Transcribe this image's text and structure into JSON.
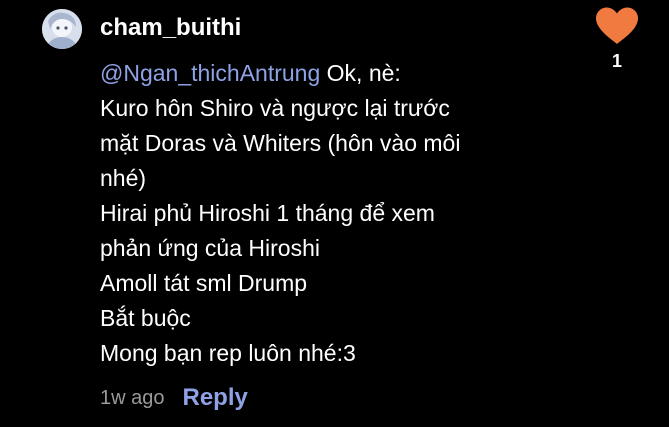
{
  "comment": {
    "avatar_icon": "user-avatar-anime",
    "username": "cham_buithi",
    "mention": "@Ngan_thichAntrung",
    "first_line_rest": " Ok, nè:",
    "lines": [
      "Kuro hôn Shiro và ngược lại trước",
      "mặt Doras và Whiters (hôn vào môi",
      "nhé)",
      "Hirai phủ Hiroshi 1 tháng để xem",
      "phản ứng của Hiroshi",
      "Amoll tát sml Drump",
      "Bắt buộc",
      "Mong bạn rep luôn nhé:3"
    ],
    "timestamp": "1w ago",
    "reply_label": "Reply",
    "like_icon": "heart-icon",
    "like_count": "1"
  },
  "colors": {
    "background": "#000000",
    "text": "#ffffff",
    "mention": "#8fa2e6",
    "reply": "#8fa2e6",
    "timestamp": "#9a9a9a",
    "heart": "#f07a3f"
  }
}
